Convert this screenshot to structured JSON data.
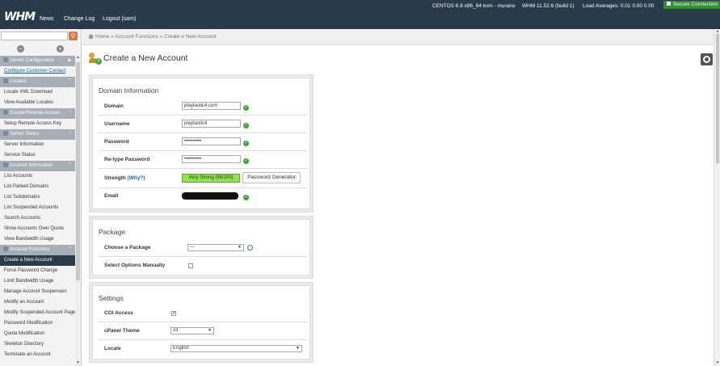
{
  "topbar": {
    "logo": "WHM",
    "nav": [
      "News",
      "Change Log",
      "Logout (sam)"
    ],
    "server_info": "CENTOS 6.8 x86_64 kvm - murano",
    "whm_version": "WHM 11.52.6 (build 1)",
    "load_averages": "Load Averages: 0.01 0.00 0.00",
    "secure_connection": "Secure Connection"
  },
  "sidebar": {
    "search_placeholder": "",
    "items": [
      {
        "label": "Server Configuration",
        "type": "cat"
      },
      {
        "label": "Configure Customer Contact",
        "type": "link"
      },
      {
        "label": "Locales",
        "type": "cat"
      },
      {
        "label": "Locale XML Download",
        "type": "item"
      },
      {
        "label": "View Available Locales",
        "type": "item"
      },
      {
        "label": "Cluster/Remote Access",
        "type": "cat"
      },
      {
        "label": "Setup Remote Access Key",
        "type": "item"
      },
      {
        "label": "Server Status",
        "type": "cat"
      },
      {
        "label": "Server Information",
        "type": "item"
      },
      {
        "label": "Service Status",
        "type": "item"
      },
      {
        "label": "Account Information",
        "type": "cat"
      },
      {
        "label": "List Accounts",
        "type": "item"
      },
      {
        "label": "List Parked Domains",
        "type": "item"
      },
      {
        "label": "List Subdomains",
        "type": "item"
      },
      {
        "label": "List Suspended Accounts",
        "type": "item"
      },
      {
        "label": "Search Accounts",
        "type": "item"
      },
      {
        "label": "Show Accounts Over Quota",
        "type": "item"
      },
      {
        "label": "View Bandwidth Usage",
        "type": "item"
      },
      {
        "label": "Account Functions",
        "type": "cat"
      },
      {
        "label": "Create a New Account",
        "type": "active"
      },
      {
        "label": "Force Password Change",
        "type": "item"
      },
      {
        "label": "Limit Bandwidth Usage",
        "type": "item"
      },
      {
        "label": "Manage Account Suspension",
        "type": "item"
      },
      {
        "label": "Modify an Account",
        "type": "item"
      },
      {
        "label": "Modify Suspended Account Page",
        "type": "item"
      },
      {
        "label": "Password Modification",
        "type": "item"
      },
      {
        "label": "Quota Modification",
        "type": "item"
      },
      {
        "label": "Skeleton Directory",
        "type": "item"
      },
      {
        "label": "Terminate an Account",
        "type": "item"
      }
    ]
  },
  "breadcrumb": {
    "home": "Home",
    "section": "Account Functions",
    "current": "Create a New Account",
    "separator": "»"
  },
  "page": {
    "title": "Create a New Account"
  },
  "domain_info": {
    "title": "Domain Information",
    "domain_label": "Domain",
    "domain_value": "playtastic4.com",
    "username_label": "Username",
    "username_value": "playtastic4",
    "password_label": "Password",
    "password_value": "••••••••••",
    "retype_label": "Re-type Password",
    "retype_value": "••••••••••",
    "strength_label": "Strength",
    "why_label": "(Why?)",
    "strength_value": "Very Strong (98/100)",
    "password_generator": "Password Generator",
    "email_label": "Email"
  },
  "package": {
    "title": "Package",
    "choose_label": "Choose a Package",
    "choose_value": "---",
    "select_manually_label": "Select Options Manually"
  },
  "settings": {
    "title": "Settings",
    "cgi_label": "CGI Access",
    "theme_label": "cPanel Theme",
    "theme_value": "x3",
    "locale_label": "Locale",
    "locale_value": "English"
  },
  "colors": {
    "topbar_bg": "#293a4a",
    "secure_bg": "#2f8f2f",
    "active_item_bg": "#2a3b4c",
    "category_bg": "#a7aeb6",
    "strength_bg": "#8ee44a",
    "ok_green": "#3aa534"
  }
}
